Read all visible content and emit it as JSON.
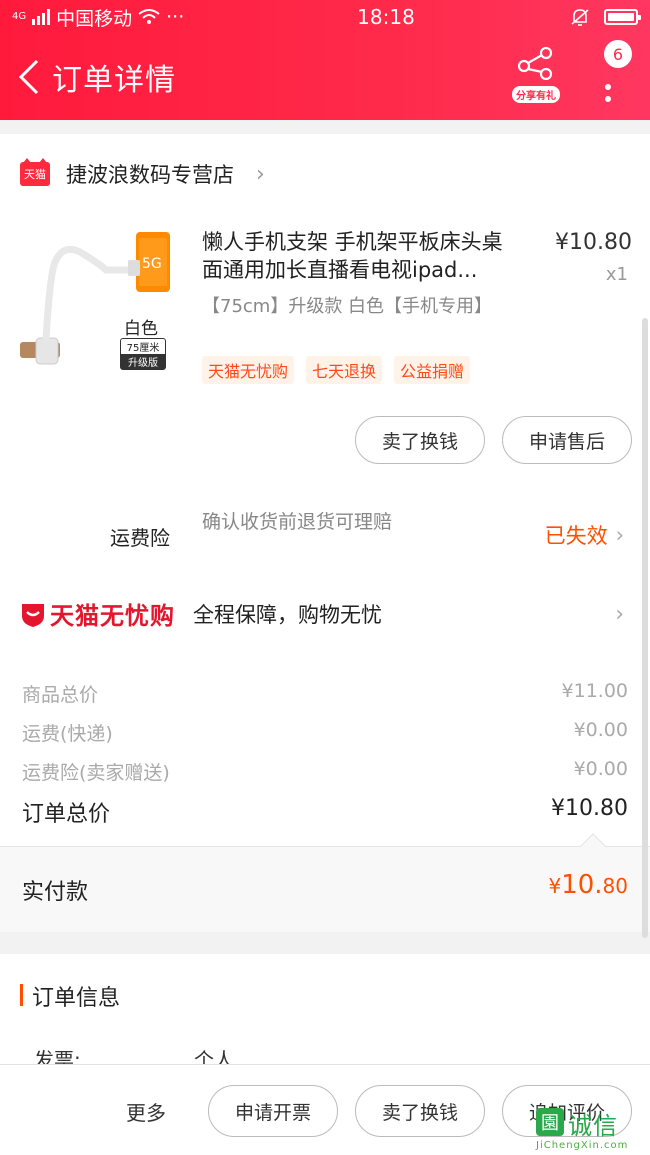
{
  "status_bar": {
    "network": "4G",
    "carrier": "中国移动",
    "more_dots": "···",
    "time": "18:18"
  },
  "header": {
    "title": "订单详情",
    "share_label": "分享有礼",
    "badge_count": "6"
  },
  "shop": {
    "platform_logo": "天猫",
    "name": "捷波浪数码专营店"
  },
  "product": {
    "title": "懒人手机支架 手机架平板床头桌面通用加长直播看电视ipad...",
    "price": "¥10.80",
    "quantity": "x1",
    "sku": "【75cm】升级款 白色【手机专用】",
    "image_labels": {
      "color": "白色",
      "size": "75厘米",
      "version": "升级版"
    },
    "tags": [
      "天猫无忧购",
      "七天退换",
      "公益捐赠"
    ],
    "actions": {
      "sell": "卖了换钱",
      "after_sale": "申请售后"
    }
  },
  "insurance": {
    "label": "运费险",
    "description": "确认收货前退货可理赔",
    "status": "已失效"
  },
  "guarantee": {
    "brand": "天猫无忧购",
    "text": "全程保障，购物无忧"
  },
  "fees": [
    {
      "label": "商品总价",
      "value": "¥11.00"
    },
    {
      "label": "运费(快递)",
      "value": "¥0.00"
    },
    {
      "label": "运费险(卖家赠送)",
      "value": "¥0.00"
    }
  ],
  "order_total": {
    "label": "订单总价",
    "value": "¥10.80"
  },
  "paid": {
    "label": "实付款",
    "currency": "¥",
    "integer": "10.",
    "cents": "80"
  },
  "order_info": {
    "title": "订单信息",
    "invoice_key": "发票:",
    "invoice_value": "个人"
  },
  "bottom_bar": {
    "more": "更多",
    "invoice": "申请开票",
    "sell": "卖了换钱",
    "review": "追加评价"
  },
  "watermark": {
    "text": "诚信",
    "icon": "園",
    "sub": "JiChengXin.com"
  },
  "colors": {
    "accent": "#ff2a4a",
    "price_orange": "#ff5000",
    "tmall_red": "#e4162e"
  }
}
